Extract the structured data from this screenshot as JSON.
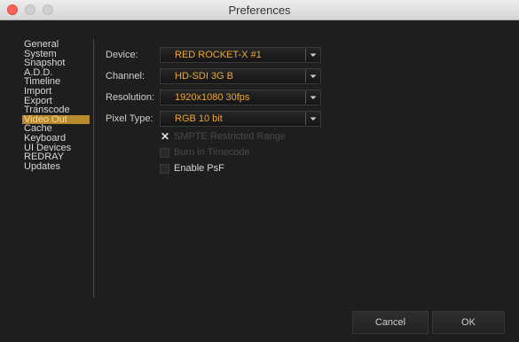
{
  "window": {
    "title": "Preferences"
  },
  "sidebar": {
    "items": [
      {
        "label": "General"
      },
      {
        "label": "System"
      },
      {
        "label": "Snapshot"
      },
      {
        "label": "A.D.D."
      },
      {
        "label": "Timeline"
      },
      {
        "label": "Import"
      },
      {
        "label": "Export"
      },
      {
        "label": "Transcode"
      },
      {
        "label": "Video Out",
        "selected": true
      },
      {
        "label": "Cache"
      },
      {
        "label": "Keyboard"
      },
      {
        "label": "UI Devices"
      },
      {
        "label": "REDRAY"
      },
      {
        "label": "Updates"
      }
    ]
  },
  "fields": {
    "device": {
      "label": "Device:",
      "value": "RED ROCKET-X #1"
    },
    "channel": {
      "label": "Channel:",
      "value": "HD-SDI 3G B"
    },
    "resolution": {
      "label": "Resolution:",
      "value": "1920x1080 30fps"
    },
    "pixel_type": {
      "label": "Pixel Type:",
      "value": "RGB 10 bit"
    }
  },
  "options": {
    "smpte": {
      "label": "SMPTE Restricted Range",
      "checked": true,
      "enabled": false
    },
    "burn_in": {
      "label": "Burn in Timecode",
      "checked": false,
      "enabled": false
    },
    "psf": {
      "label": "Enable PsF",
      "checked": false,
      "enabled": true
    }
  },
  "buttons": {
    "cancel": "Cancel",
    "ok": "OK"
  },
  "colors": {
    "accent": "#eba63b",
    "selection": "#b98a2d",
    "close": "#fc605b"
  },
  "icons": {
    "dropdown": "chevron-down-icon",
    "check": "x-mark-icon"
  }
}
